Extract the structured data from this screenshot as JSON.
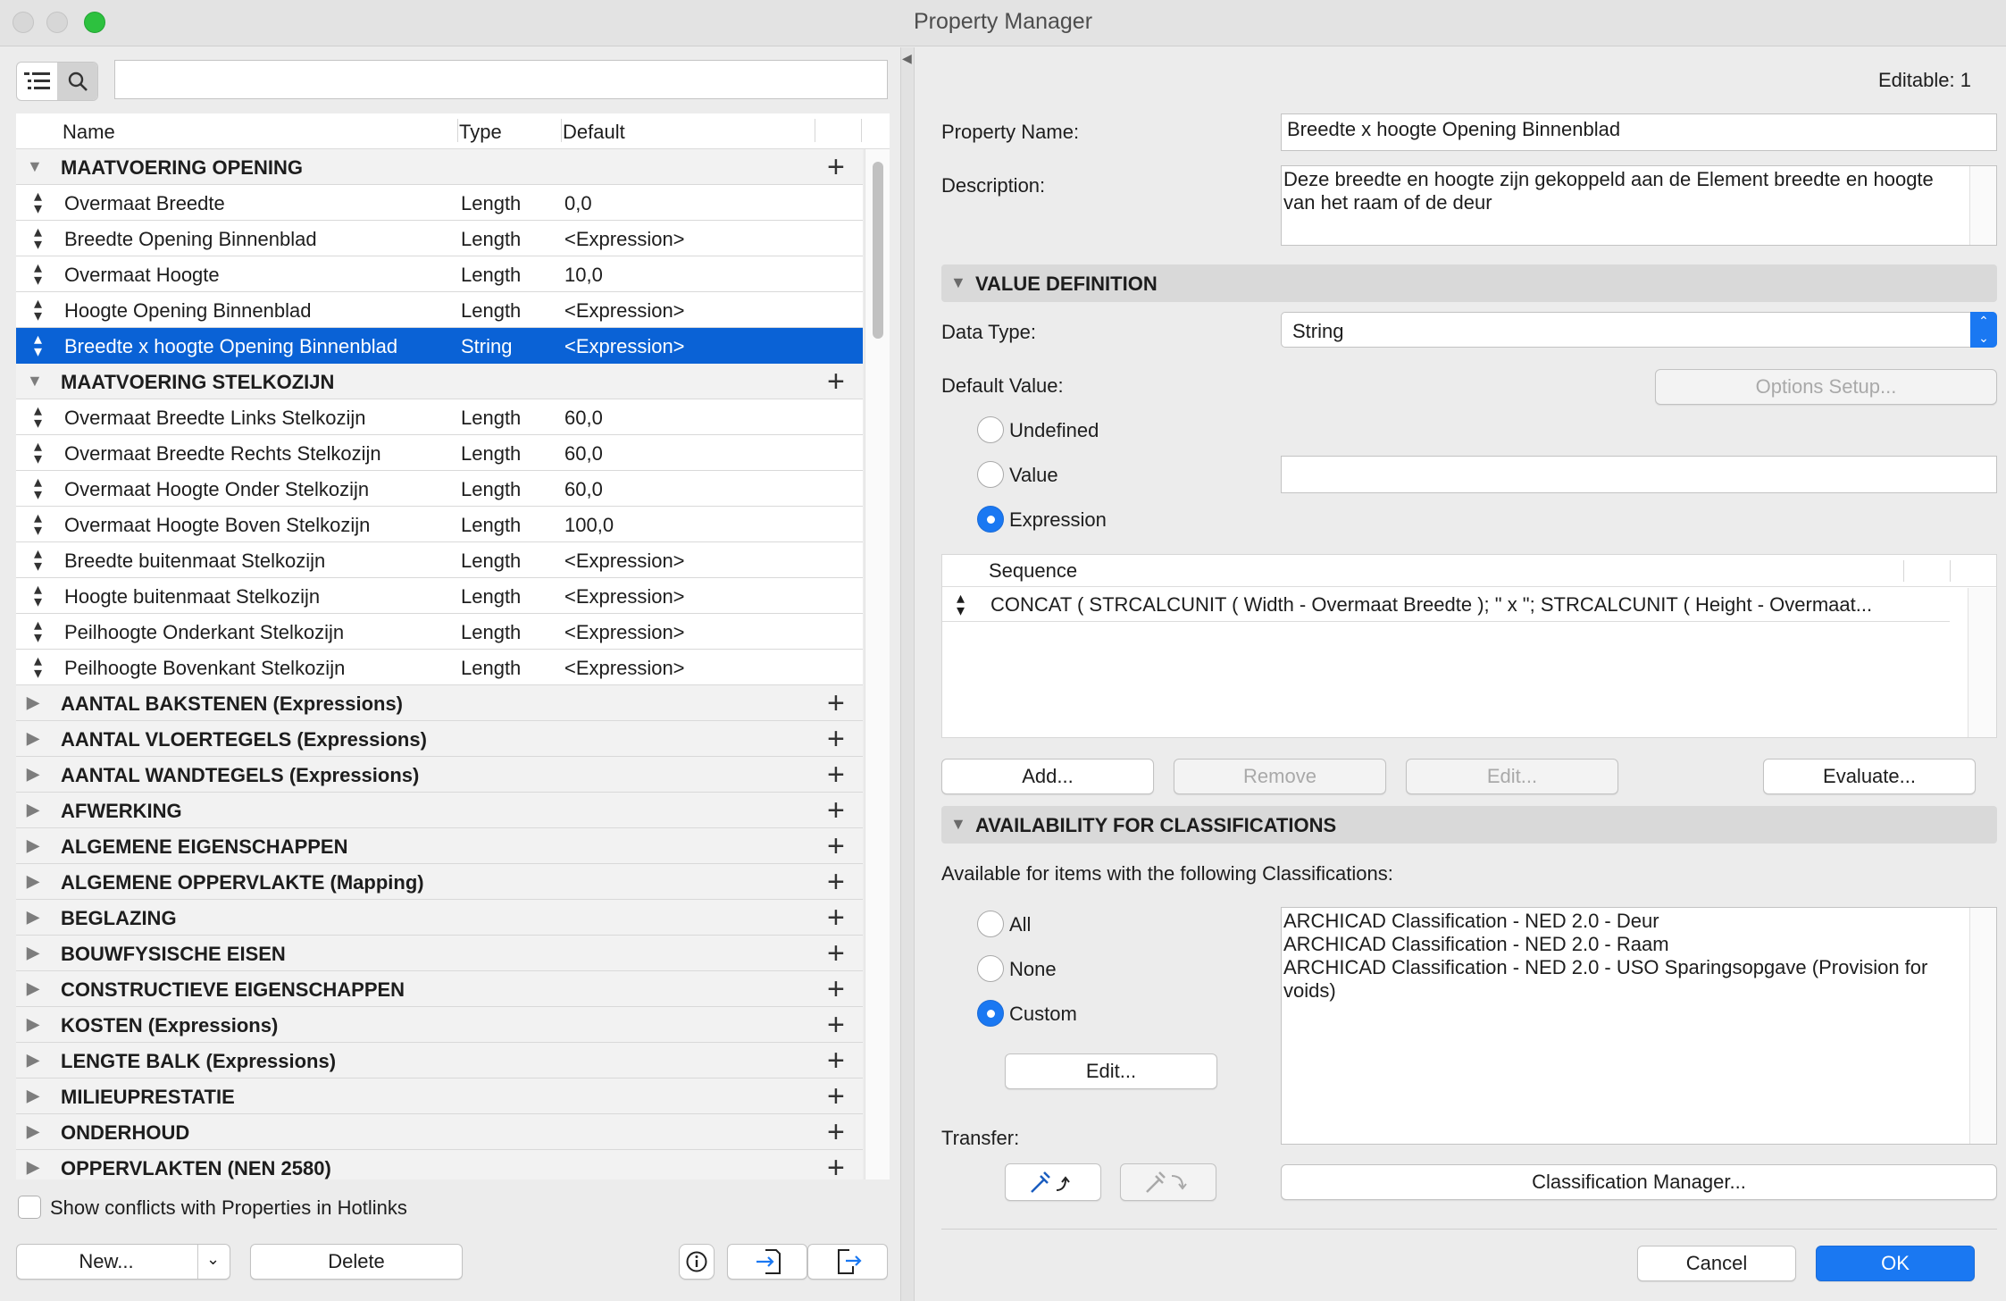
{
  "window": {
    "title": "Property Manager"
  },
  "toolbar": {
    "list_view_icon": "list-tree-icon",
    "search_icon": "search-icon",
    "search_value": ""
  },
  "list": {
    "headers": {
      "name": "Name",
      "type": "Type",
      "default": "Default"
    },
    "groups": [
      {
        "name": "MAATVOERING OPENING",
        "expanded": true,
        "items": [
          {
            "name": "Overmaat Breedte",
            "type": "Length",
            "default": "0,0"
          },
          {
            "name": "Breedte Opening Binnenblad",
            "type": "Length",
            "default": "<Expression>"
          },
          {
            "name": "Overmaat Hoogte",
            "type": "Length",
            "default": "10,0"
          },
          {
            "name": "Hoogte Opening Binnenblad",
            "type": "Length",
            "default": "<Expression>"
          },
          {
            "name": "Breedte x hoogte Opening Binnenblad",
            "type": "String",
            "default": "<Expression>",
            "selected": true
          }
        ]
      },
      {
        "name": "MAATVOERING STELKOZIJN",
        "expanded": true,
        "items": [
          {
            "name": "Overmaat Breedte Links Stelkozijn",
            "type": "Length",
            "default": "60,0"
          },
          {
            "name": "Overmaat Breedte Rechts Stelkozijn",
            "type": "Length",
            "default": "60,0"
          },
          {
            "name": "Overmaat Hoogte Onder Stelkozijn",
            "type": "Length",
            "default": "60,0"
          },
          {
            "name": "Overmaat Hoogte Boven Stelkozijn",
            "type": "Length",
            "default": "100,0"
          },
          {
            "name": "Breedte buitenmaat Stelkozijn",
            "type": "Length",
            "default": "<Expression>"
          },
          {
            "name": "Hoogte buitenmaat Stelkozijn",
            "type": "Length",
            "default": "<Expression>"
          },
          {
            "name": "Peilhoogte Onderkant Stelkozijn",
            "type": "Length",
            "default": "<Expression>"
          },
          {
            "name": "Peilhoogte Bovenkant Stelkozijn",
            "type": "Length",
            "default": "<Expression>"
          }
        ]
      },
      {
        "name": "AANTAL BAKSTENEN (Expressions)",
        "expanded": false,
        "items": []
      },
      {
        "name": "AANTAL VLOERTEGELS (Expressions)",
        "expanded": false,
        "items": []
      },
      {
        "name": "AANTAL WANDTEGELS (Expressions)",
        "expanded": false,
        "items": []
      },
      {
        "name": "AFWERKING",
        "expanded": false,
        "items": []
      },
      {
        "name": "ALGEMENE EIGENSCHAPPEN",
        "expanded": false,
        "items": []
      },
      {
        "name": "ALGEMENE OPPERVLAKTE (Mapping)",
        "expanded": false,
        "items": []
      },
      {
        "name": "BEGLAZING",
        "expanded": false,
        "items": []
      },
      {
        "name": "BOUWFYSISCHE EISEN",
        "expanded": false,
        "items": []
      },
      {
        "name": "CONSTRUCTIEVE EIGENSCHAPPEN",
        "expanded": false,
        "items": []
      },
      {
        "name": "KOSTEN (Expressions)",
        "expanded": false,
        "items": []
      },
      {
        "name": "LENGTE BALK (Expressions)",
        "expanded": false,
        "items": []
      },
      {
        "name": "MILIEUPRESTATIE",
        "expanded": false,
        "items": []
      },
      {
        "name": "ONDERHOUD",
        "expanded": false,
        "items": []
      },
      {
        "name": "OPPERVLAKTEN (NEN 2580)",
        "expanded": false,
        "items": []
      }
    ]
  },
  "left_footer": {
    "show_conflicts_label": "Show conflicts with Properties in Hotlinks",
    "new_label": "New...",
    "delete_label": "Delete"
  },
  "detail": {
    "editable": "Editable: 1",
    "property_name_label": "Property Name:",
    "property_name_value": "Breedte x hoogte Opening Binnenblad",
    "description_label": "Description:",
    "description_value": "Deze breedte en hoogte zijn gekoppeld aan de Element breedte en hoogte van het raam of de deur",
    "value_definition_header": "VALUE DEFINITION",
    "data_type_label": "Data Type:",
    "data_type_value": "String",
    "default_value_label": "Default Value:",
    "options_setup_label": "Options Setup...",
    "radio_undefined": "Undefined",
    "radio_value": "Value",
    "radio_expression": "Expression",
    "value_field": "",
    "sequence_header": "Sequence",
    "sequence_row": "CONCAT ( STRCALCUNIT ( Width - Overmaat Breedte ); \" x \"; STRCALCUNIT ( Height - Overmaat...",
    "add_label": "Add...",
    "remove_label": "Remove",
    "edit_label": "Edit...",
    "evaluate_label": "Evaluate...",
    "availability_header": "AVAILABILITY FOR CLASSIFICATIONS",
    "available_text": "Available for items with the following Classifications:",
    "radio_all": "All",
    "radio_none": "None",
    "radio_custom": "Custom",
    "classif_edit_label": "Edit...",
    "classifications": [
      "ARCHICAD Classification - NED 2.0 - Deur",
      "ARCHICAD Classification - NED 2.0 - Raam",
      "ARCHICAD Classification - NED 2.0 - USO Sparingsopgave (Provision for voids)"
    ],
    "transfer_label": "Transfer:",
    "classification_manager_label": "Classification Manager...",
    "cancel_label": "Cancel",
    "ok_label": "OK"
  },
  "colors": {
    "accent": "#1a78f2",
    "selection": "#0a62d6"
  }
}
